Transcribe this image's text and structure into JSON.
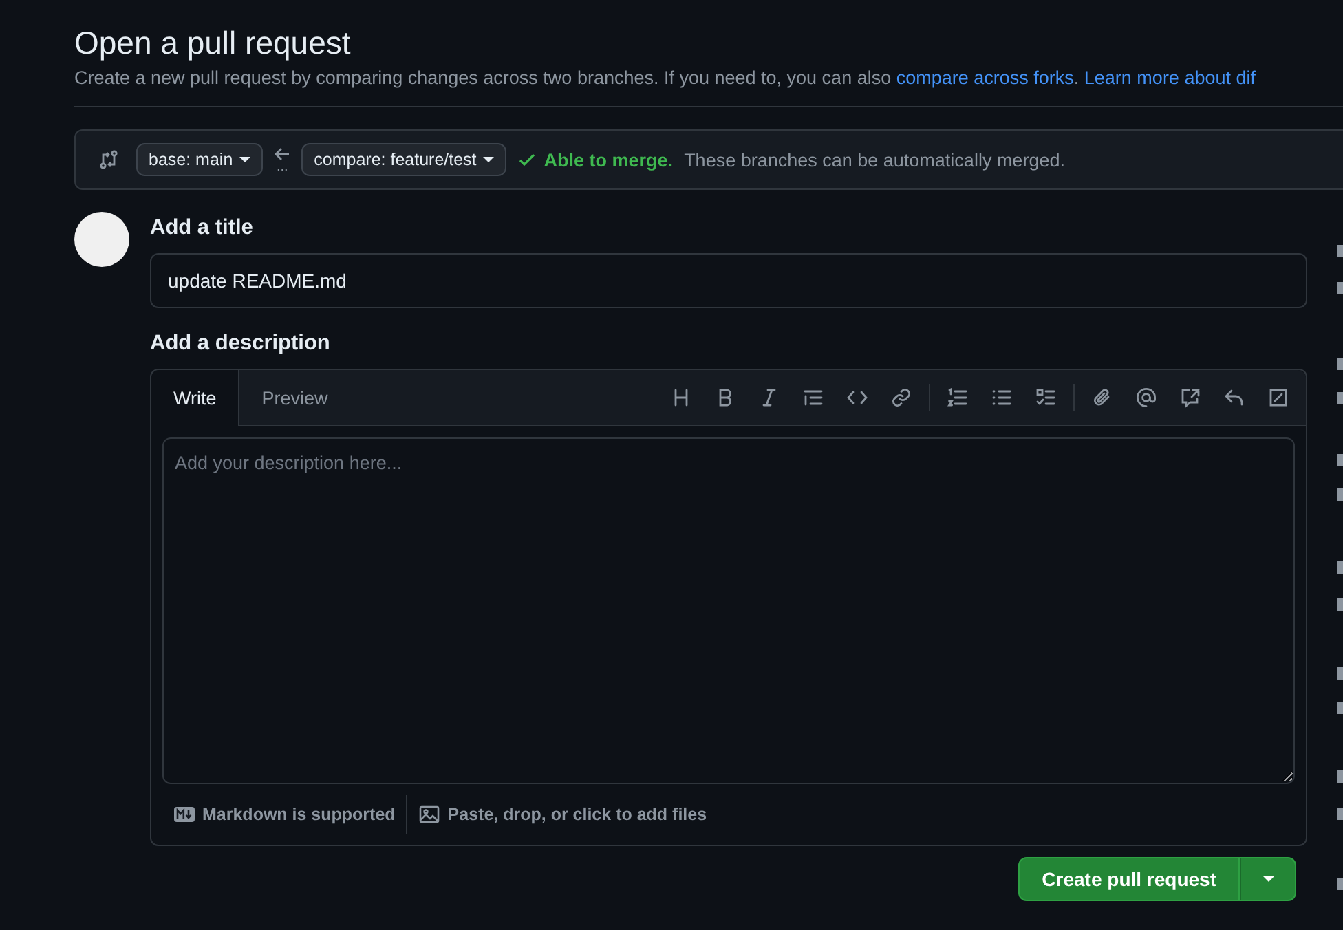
{
  "header": {
    "title": "Open a pull request",
    "description": "Create a new pull request by comparing changes across two branches. If you need to, you can also ",
    "links": [
      "compare across forks",
      ". ",
      "Learn more about dif"
    ]
  },
  "compare_bar": {
    "base": "base: main",
    "compare": "compare: feature/test",
    "dots": "...",
    "merge_status": {
      "kind": "ok",
      "label": "Able to merge.",
      "message": "These branches can be automatically merged."
    }
  },
  "form": {
    "title_label": "Add a title",
    "title_value": "update README.md",
    "description_label": "Add a description",
    "tabs": [
      {
        "label": "Write",
        "selected": true
      },
      {
        "label": "Preview",
        "selected": false
      }
    ],
    "toolbar": [
      [
        {
          "kind": "heading"
        },
        {
          "kind": "bold"
        },
        {
          "kind": "italic"
        },
        {
          "kind": "quote"
        },
        {
          "kind": "code"
        },
        {
          "kind": "link"
        }
      ],
      [
        {
          "kind": "ordered-list"
        },
        {
          "kind": "unordered-list"
        },
        {
          "kind": "task-list"
        }
      ],
      [
        {
          "kind": "attach"
        },
        {
          "kind": "mention"
        },
        {
          "kind": "reference"
        },
        {
          "kind": "reply"
        },
        {
          "kind": "slash"
        }
      ]
    ],
    "placeholder": "Add your description here...",
    "footer": [
      "Markdown is supported",
      "Paste, drop, or click to add files"
    ],
    "submit": "Create pull request"
  }
}
